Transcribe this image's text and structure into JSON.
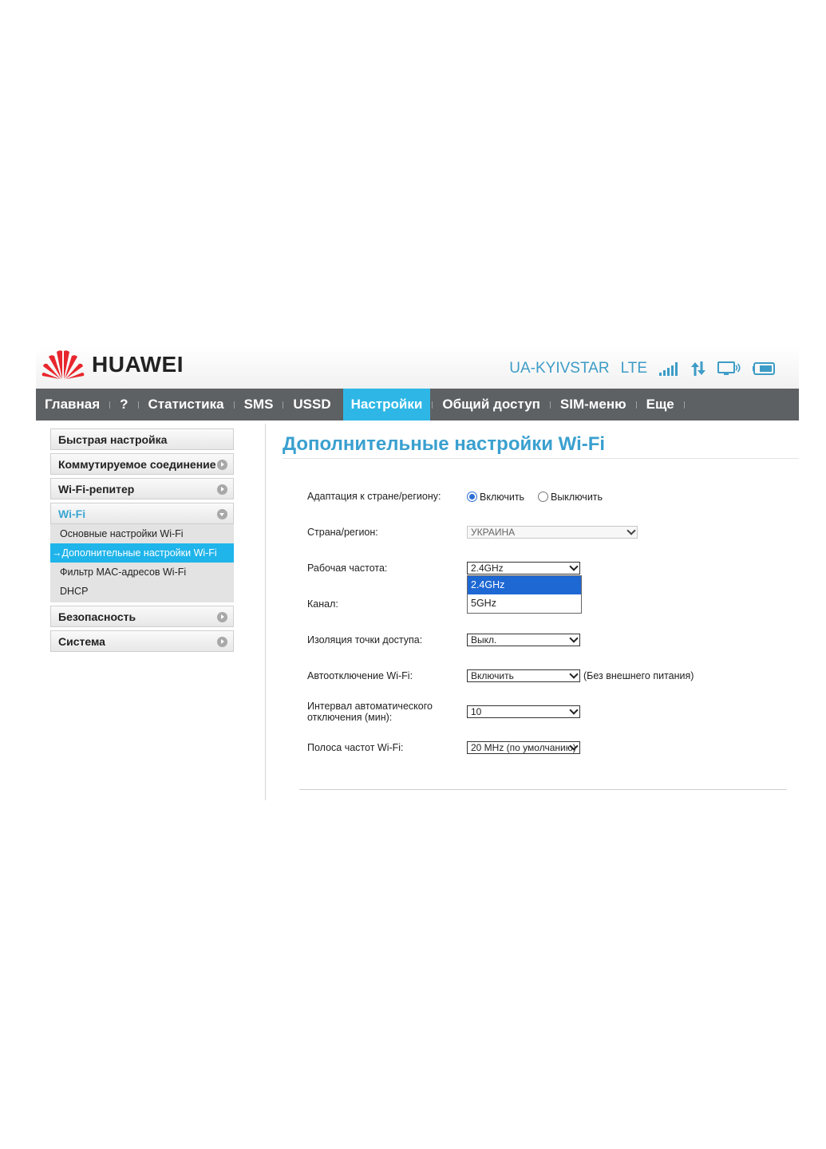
{
  "header": {
    "brand": "HUAWEI",
    "operator": "UA-KYIVSTAR",
    "network": "LTE",
    "icons": [
      "signal-icon",
      "data-transfer-icon",
      "monitor-wifi-icon",
      "battery-icon"
    ],
    "accent": "#3d9cc7",
    "logo_color": "#e8262d"
  },
  "nav": {
    "items": [
      "Главная",
      "?",
      "Статистика",
      "SMS",
      "USSD",
      "Настройки",
      "Общий доступ",
      "SIM-меню",
      "Еще"
    ],
    "active": "Настройки",
    "active_color": "#2eb7e6"
  },
  "sidebar": {
    "quick": "Быстрая настройка",
    "dialup": "Коммутируемое соединение",
    "repeater": "Wi-Fi-репитер",
    "wifi": "Wi-Fi",
    "wifi_sub": [
      "Основные настройки Wi-Fi",
      "Дополнительные настройки Wi-Fi",
      "Фильтр MAC-адресов Wi-Fi",
      "DHCP"
    ],
    "active_marker": "→",
    "security": "Безопасность",
    "system": "Система"
  },
  "main": {
    "title": "Дополнительные настройки Wi-Fi",
    "country_adapt": {
      "label": "Адаптация к стране/региону:",
      "on": "Включить",
      "off": "Выключить",
      "selected": "on"
    },
    "country": {
      "label": "Страна/регион:",
      "value": "УКРАИНА"
    },
    "frequency": {
      "label": "Рабочая частота:",
      "value": "2.4GHz",
      "options": [
        "2.4GHz",
        "5GHz"
      ],
      "highlighted": "2.4GHz"
    },
    "channel": {
      "label": "Канал:"
    },
    "isolation": {
      "label": "Изоляция точки доступа:",
      "value": "Выкл."
    },
    "autooff": {
      "label": "Автоотключение Wi-Fi:",
      "value": "Включить",
      "note": "(Без внешнего питания)"
    },
    "interval": {
      "label_1": "Интервал автоматического",
      "label_2": "отключения (мин):",
      "value": "10"
    },
    "bandwidth": {
      "label": "Полоса частот Wi-Fi:",
      "value": "20 MHz (по умолчанию)"
    }
  }
}
